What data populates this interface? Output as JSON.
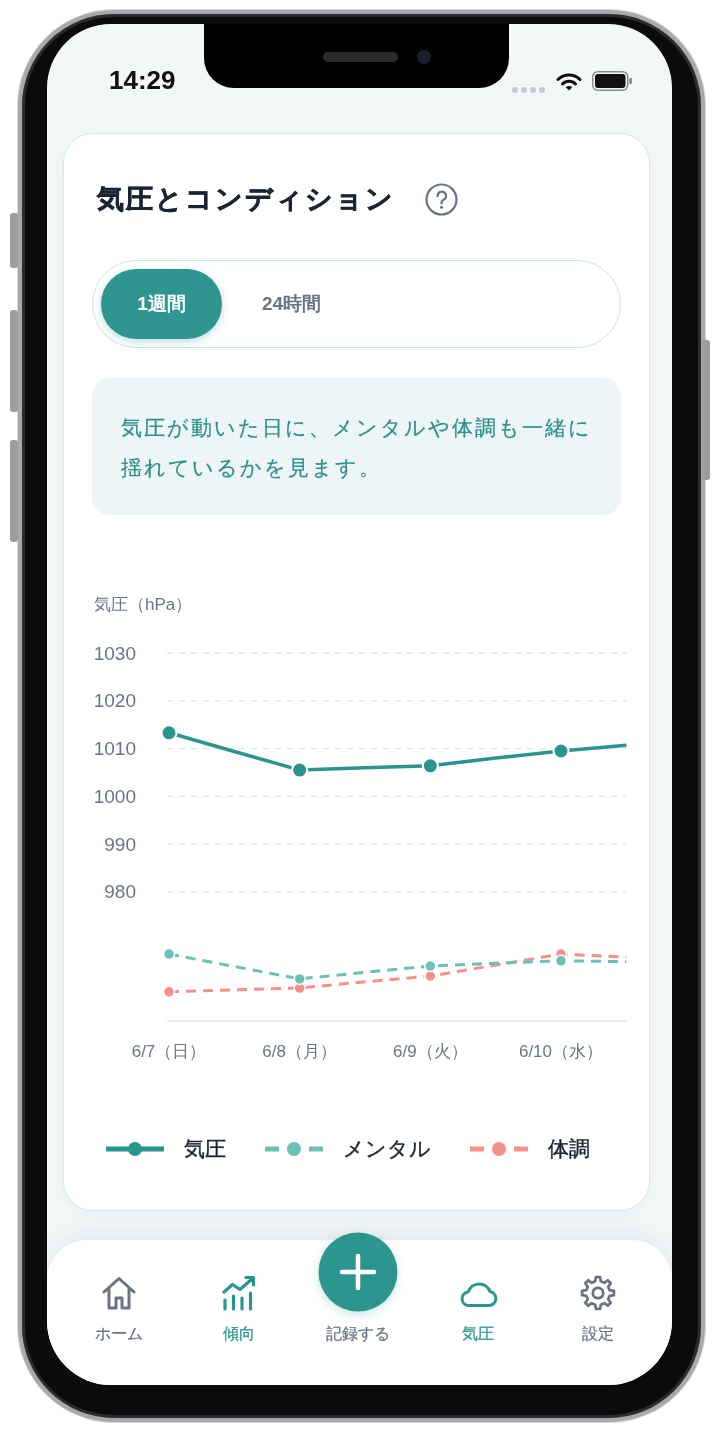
{
  "status_bar": {
    "time": "14:29"
  },
  "card": {
    "title": "気圧とコンディション",
    "period_tabs": [
      {
        "label": "1週間",
        "selected": true
      },
      {
        "label": "24時間",
        "selected": false
      }
    ],
    "info": "気圧が動いた日に、メンタルや体調も一緒に揺れているかを見ます。",
    "chart": {
      "chart_data": {
        "type": "line",
        "ylabel": "気圧（hPa）",
        "categories": [
          "6/7（日）",
          null,
          "6/8（月）",
          null,
          "6/9（火）",
          null,
          "6/10（水）",
          null
        ],
        "ylim": [
          953,
          1030
        ],
        "yticks": [
          980,
          990,
          1000,
          1010,
          1020,
          1030
        ],
        "grid": true,
        "series": [
          {
            "name": "気圧",
            "color": "#2a948f",
            "line_style": "solid",
            "marker": "o",
            "values": [
              1013.3,
              1009.4,
              1005.5,
              1006.0,
              1006.4,
              1008.0,
              1009.5,
              1010.7
            ]
          },
          {
            "name": "メンタル",
            "color": "#6cc0b7",
            "line_style": "dashed",
            "marker": "o",
            "values": [
              967.0,
              964.4,
              961.8,
              963.2,
              964.5,
              965.1,
              965.6,
              965.4
            ]
          },
          {
            "name": "体調",
            "color": "#f6908a",
            "line_style": "dashed",
            "marker": "o",
            "values": [
              959.1,
              959.5,
              959.9,
              961.2,
              962.4,
              964.7,
              967.0,
              966.4
            ]
          }
        ]
      }
    }
  },
  "bottom_nav": {
    "items": [
      {
        "label": "ホーム",
        "kind": "tab",
        "selected": false
      },
      {
        "label": "傾向",
        "kind": "tab",
        "selected": true
      },
      {
        "label": "記録する",
        "kind": "action",
        "selected": false
      },
      {
        "label": "気圧",
        "kind": "tab",
        "selected": true
      },
      {
        "label": "設定",
        "kind": "tab",
        "selected": false
      }
    ]
  }
}
